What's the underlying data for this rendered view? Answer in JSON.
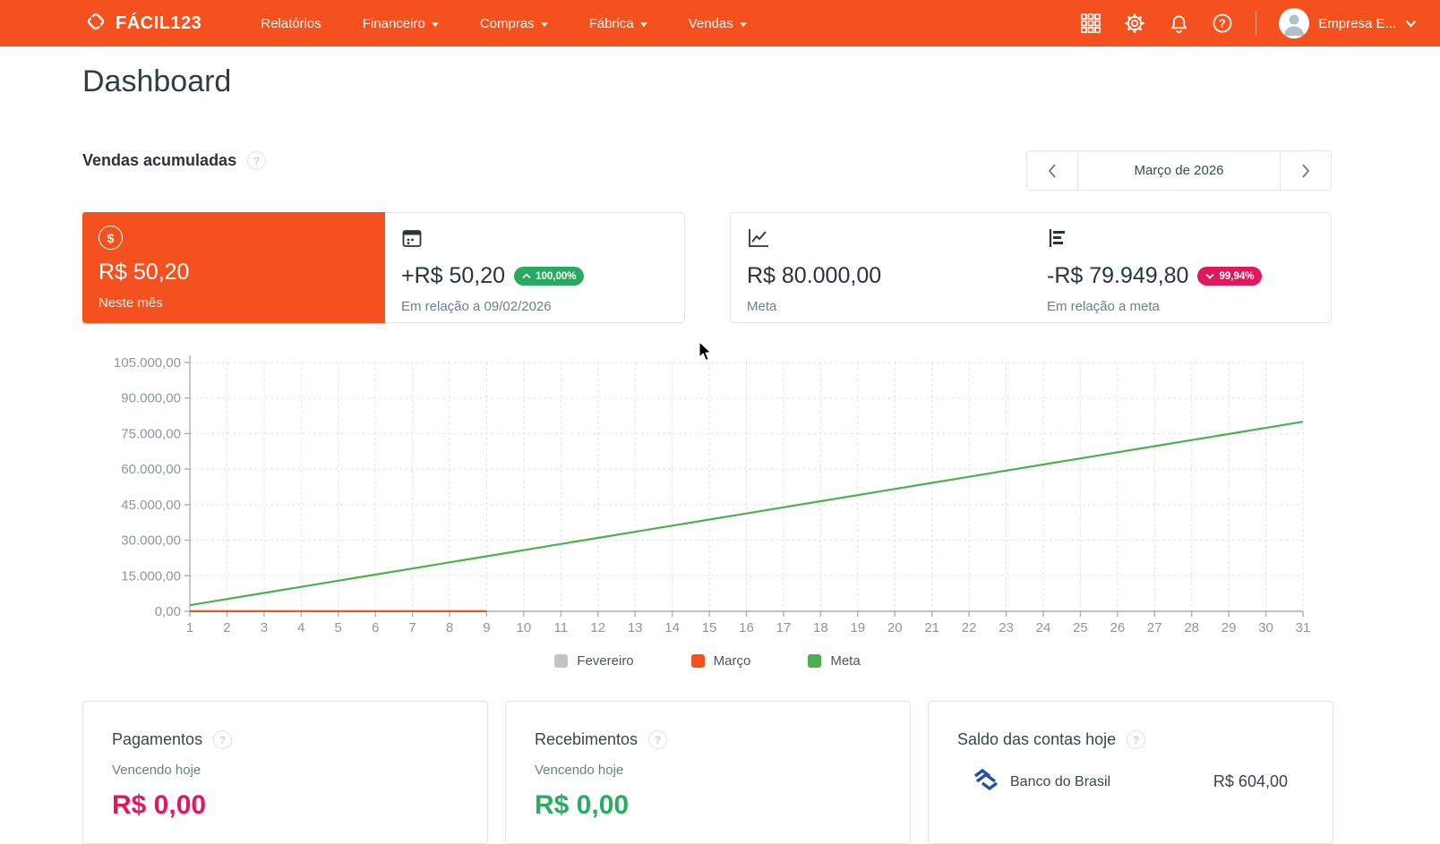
{
  "navbar": {
    "brand": "FÁCIL123",
    "items": [
      {
        "label": "Relatórios",
        "dropdown": false
      },
      {
        "label": "Financeiro",
        "dropdown": true
      },
      {
        "label": "Compras",
        "dropdown": true
      },
      {
        "label": "Fábrica",
        "dropdown": true
      },
      {
        "label": "Vendas",
        "dropdown": true
      }
    ],
    "user_name": "Empresa E..."
  },
  "page": {
    "title": "Dashboard"
  },
  "sales_section": {
    "title": "Vendas acumuladas",
    "help_glyph": "?",
    "period_label": "Março de 2026",
    "cards": {
      "current": {
        "value": "R$ 50,20",
        "label": "Neste mês",
        "icon_glyph": "$"
      },
      "comparison": {
        "value": "+R$ 50,20",
        "badge": "100,00%",
        "label": "Em relação a 09/02/2026"
      },
      "meta": {
        "value": "R$ 80.000,00",
        "label": "Meta"
      },
      "vs_meta": {
        "value": "-R$ 79.949,80",
        "badge": "99,94%",
        "label": "Em relação a meta"
      }
    }
  },
  "chart_data": {
    "type": "line",
    "x": [
      1,
      2,
      3,
      4,
      5,
      6,
      7,
      8,
      9,
      10,
      11,
      12,
      13,
      14,
      15,
      16,
      17,
      18,
      19,
      20,
      21,
      22,
      23,
      24,
      25,
      26,
      27,
      28,
      29,
      30,
      31
    ],
    "ylim": [
      0,
      105000
    ],
    "grid": true,
    "legend_position": "bottom",
    "yticks": [
      {
        "value": 0,
        "label": "0,00"
      },
      {
        "value": 15000,
        "label": "15.000,00"
      },
      {
        "value": 30000,
        "label": "30.000,00"
      },
      {
        "value": 45000,
        "label": "45.000,00"
      },
      {
        "value": 60000,
        "label": "60.000,00"
      },
      {
        "value": 75000,
        "label": "75.000,00"
      },
      {
        "value": 90000,
        "label": "90.000,00"
      },
      {
        "value": 105000,
        "label": "105.000,00"
      }
    ],
    "series": [
      {
        "name": "Fevereiro",
        "color": "#c0c6c8",
        "values": []
      },
      {
        "name": "Março",
        "color": "#f4511e",
        "values": [
          50.2,
          50.2,
          50.2,
          50.2,
          50.2,
          50.2,
          50.2,
          50.2,
          50.2
        ]
      },
      {
        "name": "Meta",
        "color": "#4caf50",
        "values": [
          2580.65,
          5161.29,
          7741.94,
          10322.58,
          12903.23,
          15483.87,
          18064.52,
          20645.16,
          23225.81,
          25806.45,
          28387.1,
          30967.74,
          33548.39,
          36129.03,
          38709.68,
          41290.32,
          43870.97,
          46451.61,
          49032.26,
          51612.9,
          54193.55,
          56774.19,
          59354.84,
          61935.48,
          64516.13,
          67096.77,
          69677.42,
          72258.06,
          74838.71,
          77419.35,
          80000.0
        ]
      }
    ]
  },
  "bottom_cards": {
    "pagamentos": {
      "title": "Pagamentos",
      "subtitle": "Vencendo hoje",
      "value": "R$ 0,00"
    },
    "recebimentos": {
      "title": "Recebimentos",
      "subtitle": "Vencendo hoje",
      "value": "R$ 0,00"
    },
    "saldo": {
      "title": "Saldo das contas hoje",
      "accounts": [
        {
          "name": "Banco do Brasil",
          "value": "R$ 604,00"
        }
      ]
    }
  },
  "colors": {
    "accent_orange": "#f4511e",
    "badge_green": "#28a960",
    "badge_pink": "#e0195f",
    "meta_green": "#4caf50",
    "fevereiro_gray": "#c0c6c8",
    "bb_blue": "#2350a0"
  }
}
